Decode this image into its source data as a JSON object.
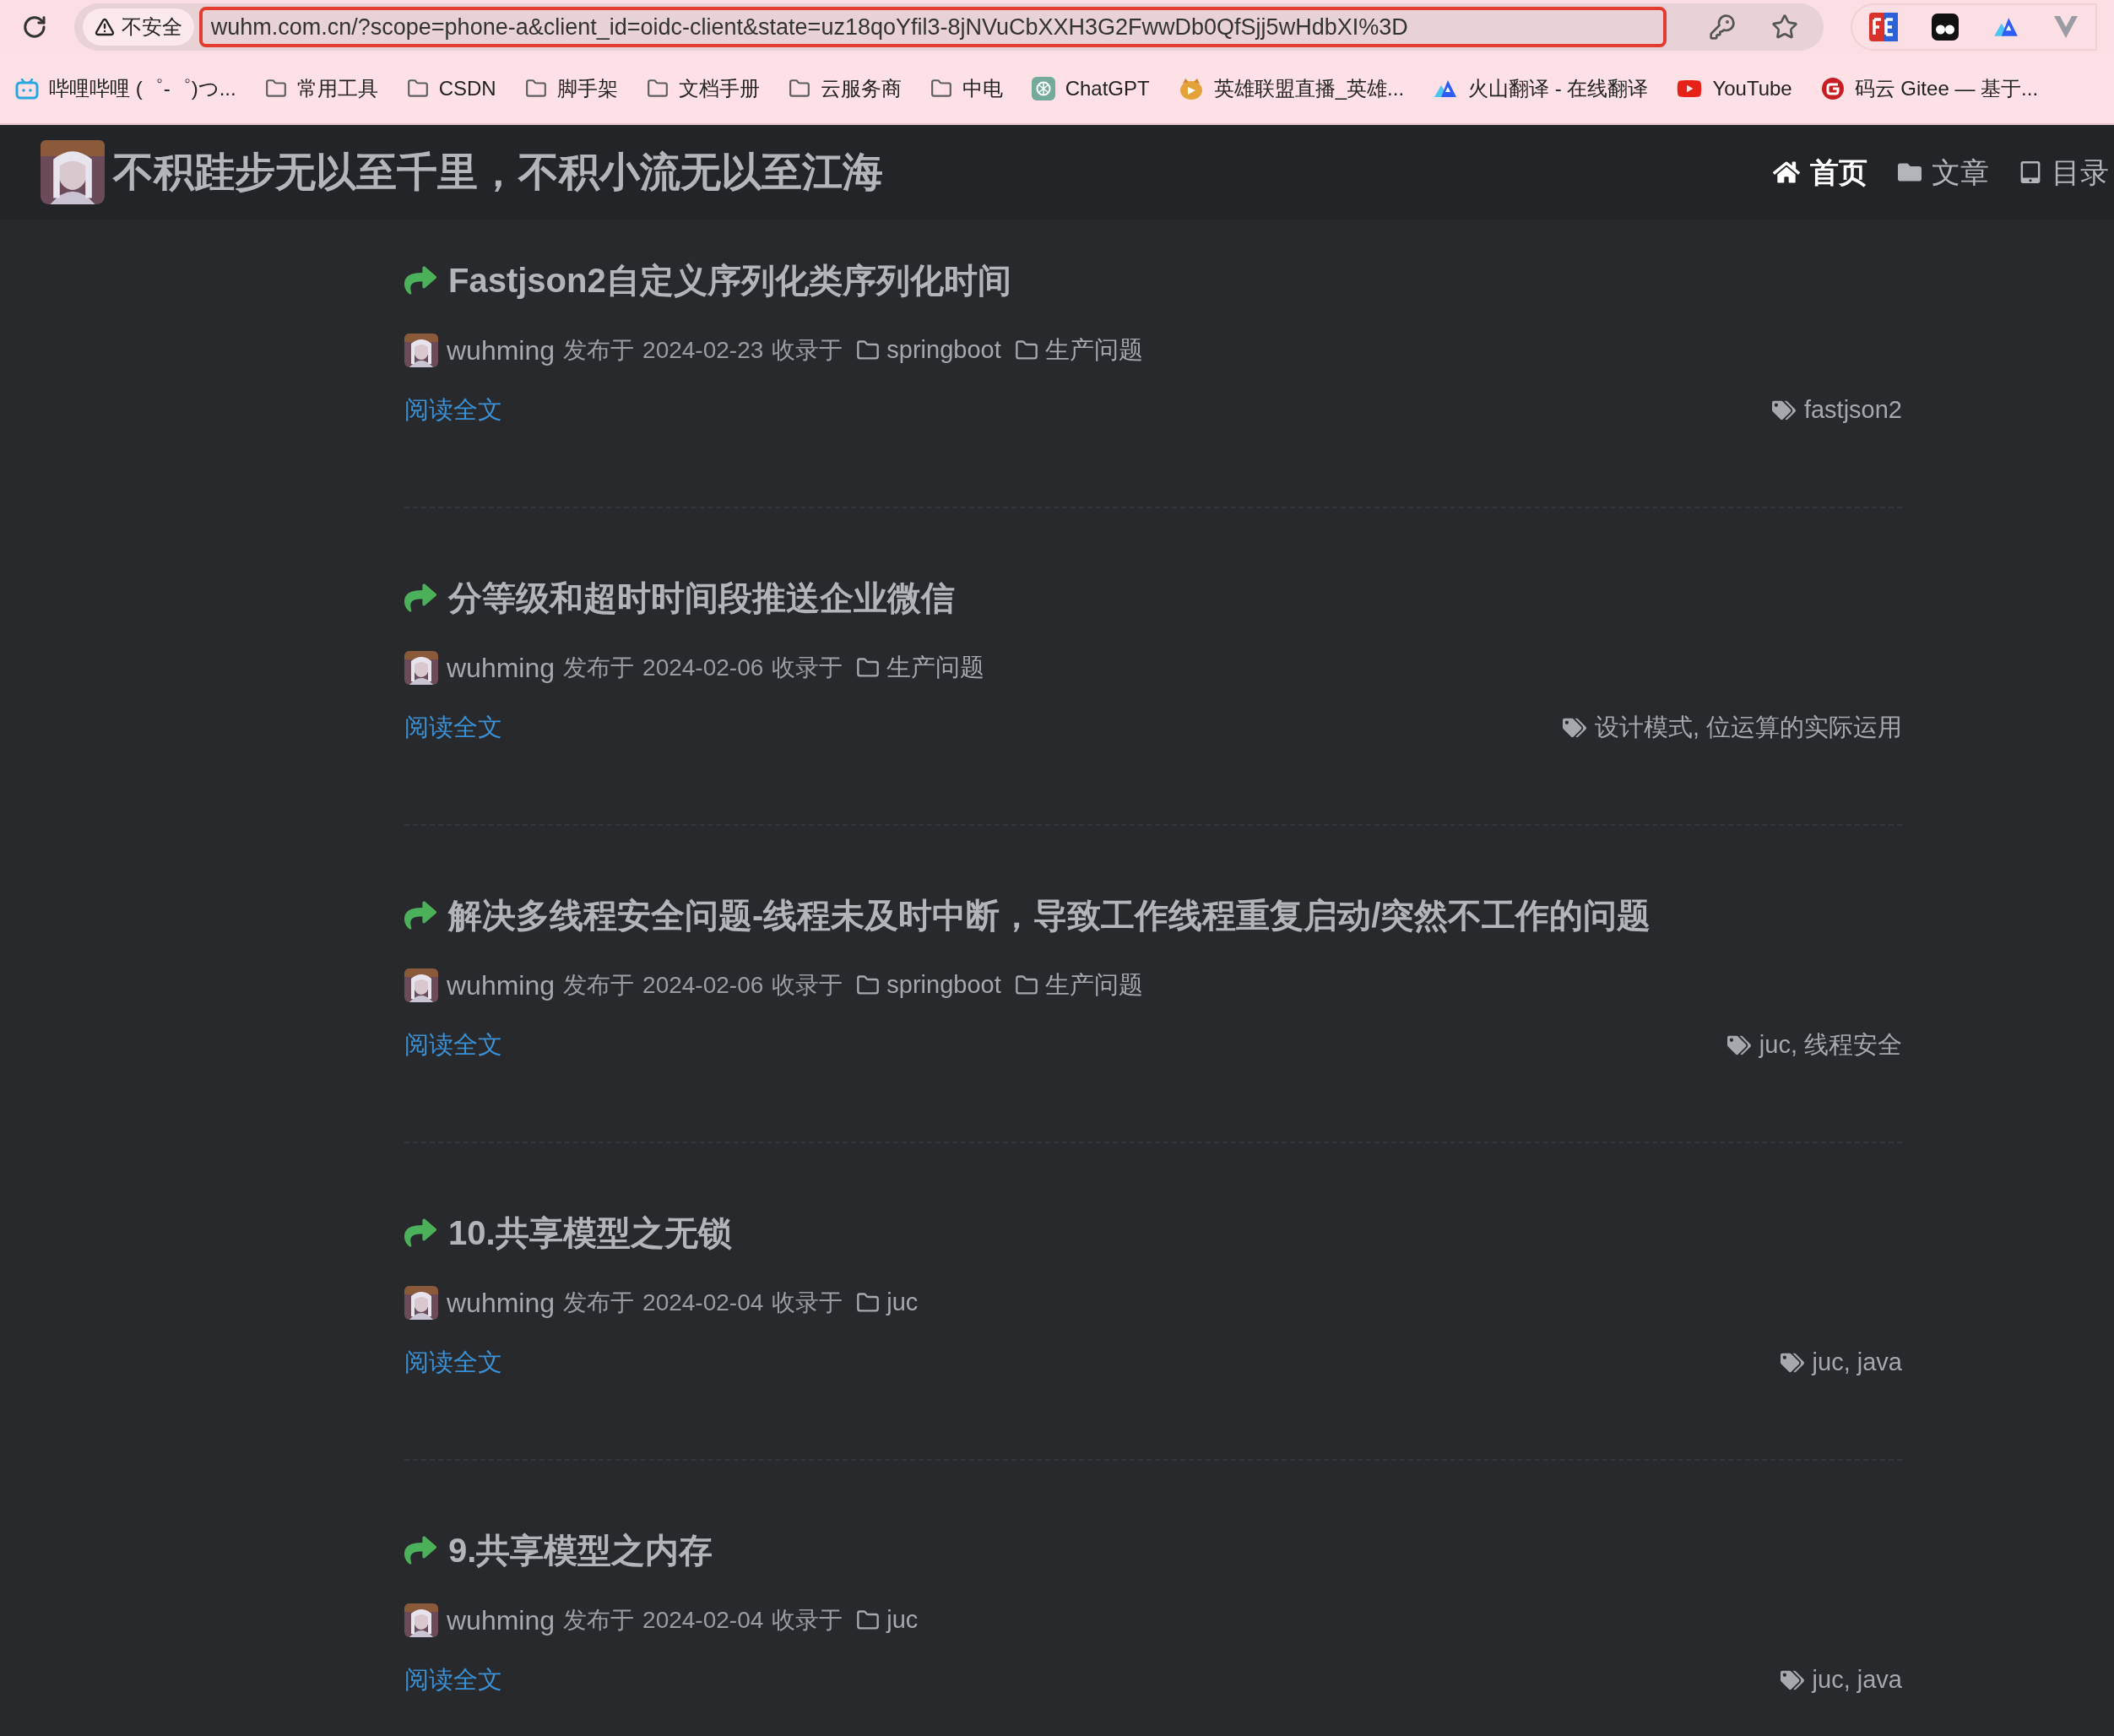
{
  "browser": {
    "security_label": "不安全",
    "url": "wuhm.com.cn/?scope=phone-a&client_id=oidc-client&state=uz18qoYfil3-8jNVuCbXXH3G2FwwDb0QfSjj5wHdbXI%3D"
  },
  "bookmarks": [
    {
      "kind": "tv",
      "label": "哔哩哔哩 (゜-゜)つ..."
    },
    {
      "kind": "folder",
      "label": "常用工具"
    },
    {
      "kind": "folder",
      "label": "CSDN"
    },
    {
      "kind": "folder",
      "label": "脚手架"
    },
    {
      "kind": "folder",
      "label": "文档手册"
    },
    {
      "kind": "folder",
      "label": "云服务商"
    },
    {
      "kind": "folder",
      "label": "中电"
    },
    {
      "kind": "knot",
      "label": "ChatGPT"
    },
    {
      "kind": "mascot",
      "label": "英雄联盟直播_英雄..."
    },
    {
      "kind": "triangle",
      "label": "火山翻译 - 在线翻译"
    },
    {
      "kind": "play",
      "label": "YouTube"
    },
    {
      "kind": "ring",
      "label": "码云 Gitee — 基于..."
    }
  ],
  "site": {
    "title": "不积跬步无以至千里，不积小流无以至江海",
    "nav": [
      {
        "kind": "home",
        "label": "首页",
        "selected": true
      },
      {
        "kind": "folder",
        "label": "文章",
        "selected": false
      },
      {
        "kind": "tablet",
        "label": "目录",
        "selected": false
      }
    ]
  },
  "posts": [
    {
      "title": "Fastjson2自定义序列化类序列化时间",
      "author": "wuhming",
      "published_label": "发布于",
      "date": "2024-02-23",
      "filed_label": "收录于",
      "categories": [
        "springboot",
        "生产问题"
      ],
      "read_more": "阅读全文",
      "tags": "fastjson2"
    },
    {
      "title": "分等级和超时时间段推送企业微信",
      "author": "wuhming",
      "published_label": "发布于",
      "date": "2024-02-06",
      "filed_label": "收录于",
      "categories": [
        "生产问题"
      ],
      "read_more": "阅读全文",
      "tags": "设计模式, 位运算的实际运用"
    },
    {
      "title": "解决多线程安全问题-线程未及时中断，导致工作线程重复启动/突然不工作的问题",
      "author": "wuhming",
      "published_label": "发布于",
      "date": "2024-02-06",
      "filed_label": "收录于",
      "categories": [
        "springboot",
        "生产问题"
      ],
      "read_more": "阅读全文",
      "tags": "juc, 线程安全"
    },
    {
      "title": "10.共享模型之无锁",
      "author": "wuhming",
      "published_label": "发布于",
      "date": "2024-02-04",
      "filed_label": "收录于",
      "categories": [
        "juc"
      ],
      "read_more": "阅读全文",
      "tags": "juc, java"
    },
    {
      "title": "9.共享模型之内存",
      "author": "wuhming",
      "published_label": "发布于",
      "date": "2024-02-04",
      "filed_label": "收录于",
      "categories": [
        "juc"
      ],
      "read_more": "阅读全文",
      "tags": "juc, java"
    }
  ]
}
